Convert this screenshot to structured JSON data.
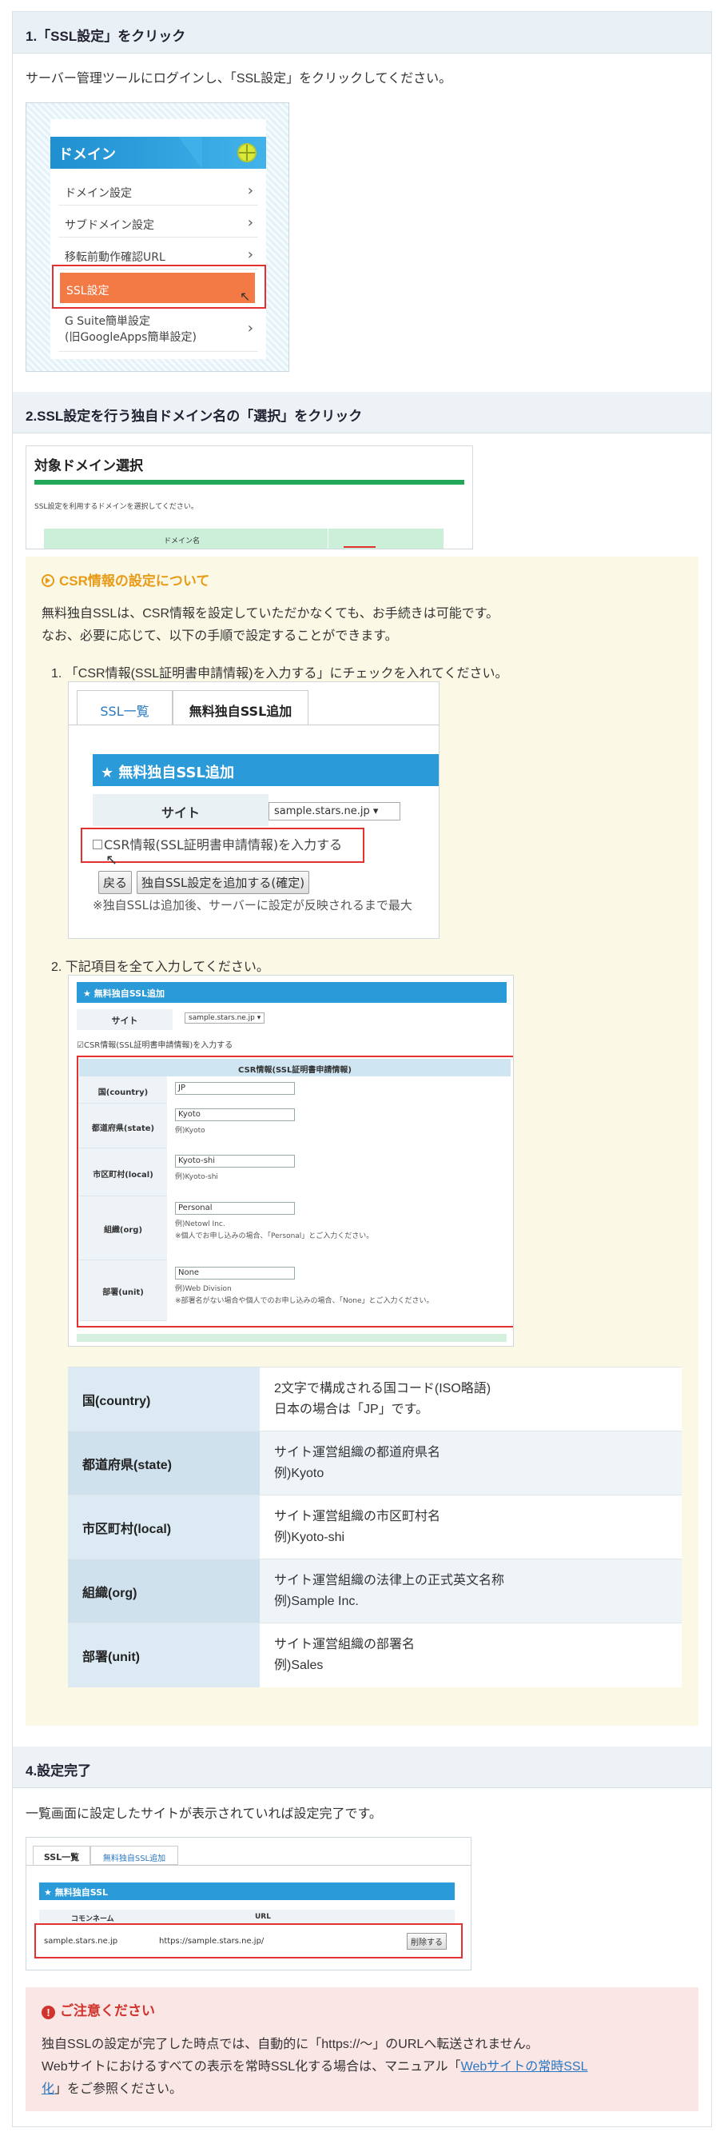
{
  "sections": {
    "s1": {
      "title": "1.「SSL設定」をクリック",
      "desc": "サーバー管理ツールにログインし、「SSL設定」をクリックしてください。"
    },
    "s2": {
      "title": "2.SSL設定を行う独自ドメイン名の「選択」をクリック"
    },
    "s4": {
      "title": "4.設定完了",
      "desc": "一覧画面に設定したサイトが表示されていれば設定完了です。"
    }
  },
  "shot1": {
    "header": "ドメイン",
    "items": [
      "ドメイン設定",
      "サブドメイン設定",
      "移転前動作確認URL",
      "SSL設定",
      "G Suite簡単設定",
      "(旧GoogleApps簡単設定)"
    ]
  },
  "shot2": {
    "title": "対象ドメイン選択",
    "desc": "SSL設定を利用するドメインを選択してください。",
    "col": "ドメイン名"
  },
  "csr": {
    "title": "CSR情報の設定について",
    "line1": "無料独自SSLは、CSR情報を設定していただかなくても、お手続きは可能です。",
    "line2": "なお、必要に応じて、以下の手順で設定することができます。",
    "step1": "1. 「CSR情報(SSL証明書申請情報)を入力する」にチェックを入れてください。",
    "step2": "2. 下記項目を全て入力してください。"
  },
  "shot3": {
    "tab1": "SSL一覧",
    "tab2": "無料独自SSL追加",
    "bar": "★ 無料独自SSL追加",
    "site_label": "サイト",
    "site_value": "sample.stars.ne.jp ▾",
    "checkbox": "CSR情報(SSL証明書申請情報)を入力する",
    "back": "戻る",
    "confirm": "独自SSL設定を追加する(確定)",
    "note": "※独自SSLは追加後、サーバーに設定が反映されるまで最大"
  },
  "shot4": {
    "bar": "★ 無料独自SSL追加",
    "site_label": "サイト",
    "site_value": "sample.stars.ne.jp ▾",
    "checkbox": "☑CSR情報(SSL証明書申請情報)を入力する",
    "table_head": "CSR情報(SSL証明書申請情報)",
    "rows": [
      {
        "label": "国(country)",
        "value": "JP",
        "ex": ""
      },
      {
        "label": "都道府県(state)",
        "value": "Kyoto",
        "ex": "例)Kyoto"
      },
      {
        "label": "市区町村(local)",
        "value": "Kyoto-shi",
        "ex": "例)Kyoto-shi"
      },
      {
        "label": "組織(org)",
        "value": "Personal",
        "ex": "例)Netowl Inc.",
        "ex2": "※個人でお申し込みの場合、「Personal」とご入力ください。"
      },
      {
        "label": "部署(unit)",
        "value": "None",
        "ex": "例)Web Division",
        "ex2": "※部署名がない場合や個人でのお申し込みの場合、「None」とご入力ください。"
      }
    ]
  },
  "fields": [
    {
      "key": "国(country)",
      "v1": "2文字で構成される国コード(ISO略語)",
      "v2": "日本の場合は「JP」です。"
    },
    {
      "key": "都道府県(state)",
      "v1": "サイト運営組織の都道府県名",
      "v2": "例)Kyoto"
    },
    {
      "key": "市区町村(local)",
      "v1": "サイト運営組織の市区町村名",
      "v2": "例)Kyoto-shi"
    },
    {
      "key": "組織(org)",
      "v1": "サイト運営組織の法律上の正式英文名称",
      "v2": "例)Sample Inc."
    },
    {
      "key": "部署(unit)",
      "v1": "サイト運営組織の部署名",
      "v2": "例)Sales"
    }
  ],
  "shot5": {
    "tab1": "SSL一覧",
    "tab2": "無料独自SSL追加",
    "bar": "★ 無料独自SSL",
    "col1": "コモンネーム",
    "col2": "URL",
    "cell1": "sample.stars.ne.jp",
    "cell2": "https://sample.stars.ne.jp/",
    "delete": "削除する"
  },
  "note": {
    "title": "ご注意ください",
    "line1": "独自SSLの設定が完了した時点では、自動的に「https://～」のURLへ転送されません。",
    "line2a": "Webサイトにおけるすべての表示を常時SSL化する場合は、マニュアル「",
    "link1": "Webサイトの常時SSL",
    "link2": "化",
    "line3b": "」をご参照ください。"
  },
  "colors": {
    "accent": "#2a9ad8",
    "highlight": "#e3312f",
    "active": "#f37a45",
    "note_bg": "#fbe6e6",
    "csr_bg": "#fbf8e6"
  }
}
